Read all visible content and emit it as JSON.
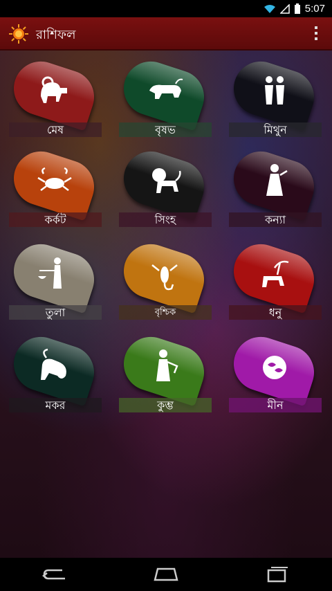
{
  "status": {
    "time": "5:07"
  },
  "app": {
    "title": "রাশিফল"
  },
  "signs": [
    {
      "label": "মেষ",
      "color": "#8e1a1a",
      "labelbg": "rgba(60,30,40,0.7)"
    },
    {
      "label": "বৃষভ",
      "color": "#0f4a2a",
      "labelbg": "rgba(40,70,50,0.75)"
    },
    {
      "label": "মিথুন",
      "color": "#101018",
      "labelbg": "rgba(40,40,45,0.75)"
    },
    {
      "label": "কর্কট",
      "color": "#b8420c",
      "labelbg": "rgba(80,25,30,0.75)"
    },
    {
      "label": "সিংহ",
      "color": "#151515",
      "labelbg": "rgba(60,20,40,0.75)"
    },
    {
      "label": "কন্যা",
      "color": "#2a0a1a",
      "labelbg": "rgba(50,20,35,0.75)"
    },
    {
      "label": "তুলা",
      "color": "#888070",
      "labelbg": "rgba(70,65,70,0.75)"
    },
    {
      "label": "বৃশ্চিক",
      "color": "#c07410",
      "labelbg": "rgba(70,50,30,0.75)"
    },
    {
      "label": "ধনু",
      "color": "#a81010",
      "labelbg": "rgba(70,20,30,0.75)"
    },
    {
      "label": "মকর",
      "color": "#0c2a24",
      "labelbg": "rgba(30,25,30,0.7)"
    },
    {
      "label": "কুম্ভ",
      "color": "#3a7a1a",
      "labelbg": "rgba(70,100,40,0.75)"
    },
    {
      "label": "মীন",
      "color": "#a01aa8",
      "labelbg": "rgba(110,20,110,0.8)"
    }
  ]
}
